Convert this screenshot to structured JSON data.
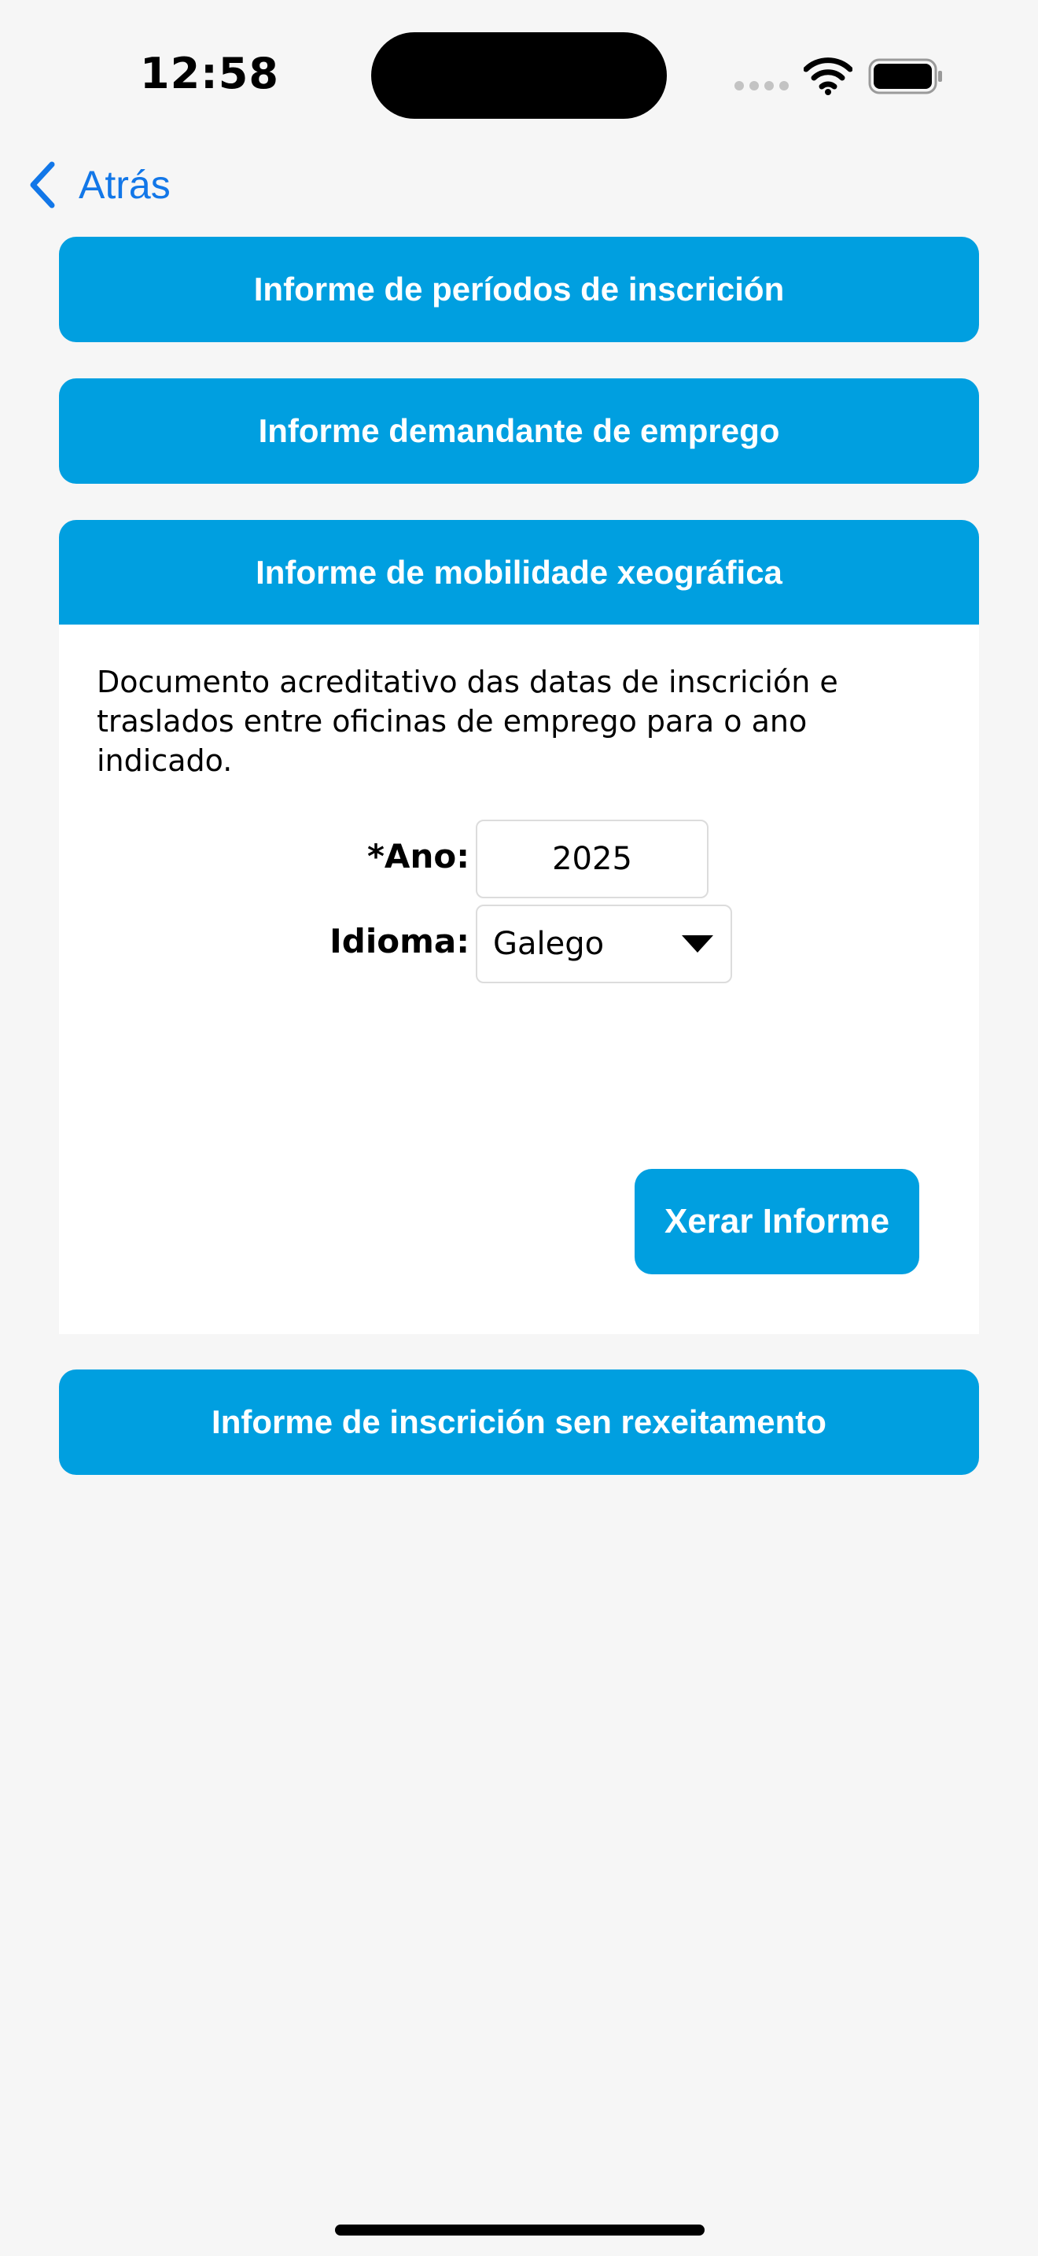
{
  "status_bar": {
    "time": "12:58"
  },
  "nav": {
    "back_label": "Atrás"
  },
  "sections": [
    {
      "label": "Informe de períodos de inscrición",
      "expanded": false
    },
    {
      "label": "Informe demandante de emprego",
      "expanded": false
    },
    {
      "label": "Informe de mobilidade xeográfica",
      "expanded": true
    },
    {
      "label": "Informe de inscrición sen rexeitamento",
      "expanded": false
    }
  ],
  "panel": {
    "description": "Documento acreditativo das datas de inscrición e traslados entre oficinas de emprego para o ano indicado.",
    "year_label": "*Ano:",
    "year_value": "2025",
    "language_label": "Idioma:",
    "language_value": "Galego",
    "generate_label": "Xerar Informe"
  },
  "colors": {
    "accent": "#009fe0",
    "link": "#1277e8",
    "background": "#f6f6f6"
  }
}
